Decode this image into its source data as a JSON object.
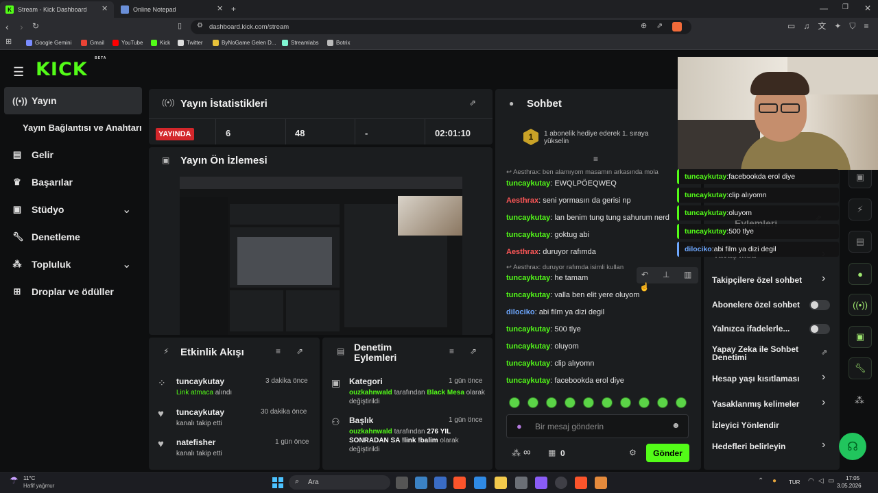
{
  "browser": {
    "tabs": [
      {
        "label": "Stream - Kick Dashboard",
        "icon": "kick-icon"
      },
      {
        "label": "Online Notepad",
        "icon": "notepad-icon"
      }
    ],
    "url": "dashboard.kick.com/stream",
    "bookmarks": [
      "Google Gemini",
      "Gmail",
      "YouTube",
      "Kick",
      "Twitter",
      "ByNoGame Gelen D...",
      "Streamlabs",
      "Botrix"
    ]
  },
  "sidebar": {
    "brand": "KICK",
    "brand_badge": "BETA",
    "items": [
      {
        "label": "Yayın",
        "icon": "broadcast-icon"
      },
      {
        "label": "Yayın Bağlantısı ve Anahtarı"
      },
      {
        "label": "Gelir",
        "icon": "revenue-icon"
      },
      {
        "label": "Başarılar",
        "icon": "trophy-icon"
      },
      {
        "label": "Stüdyo",
        "icon": "studio-icon"
      },
      {
        "label": "Denetleme",
        "icon": "wrench-icon"
      },
      {
        "label": "Topluluk",
        "icon": "community-icon"
      },
      {
        "label": "Droplar ve ödüller",
        "icon": "gift-icon"
      }
    ]
  },
  "stats": {
    "title": "Yayın İstatistikleri",
    "live_badge": "YAYINDA",
    "values": [
      "6",
      "48",
      "-",
      "02:01:10"
    ]
  },
  "preview": {
    "title": "Yayın Ön İzlemesi"
  },
  "activity": {
    "title": "Etkinlik Akışı",
    "items": [
      {
        "name": "tuncaykutay",
        "detail_link": "Link atmaca",
        "detail": "alındı",
        "time": "3 dakika önce"
      },
      {
        "name": "tuncaykutay",
        "detail": "kanalı takip etti",
        "time": "30 dakika önce"
      },
      {
        "name": "natefisher",
        "detail": "kanalı takip etti",
        "time": "1 gün önce"
      }
    ]
  },
  "moderation": {
    "title_line1": "Denetim",
    "title_line2": "Eylemleri",
    "items": [
      {
        "title": "Kategori",
        "time": "1 gün önce",
        "user": "ouzkahnwald",
        "mid": "tarafından",
        "value": "Black Mesa",
        "tail": "olarak değiştirildi"
      },
      {
        "title": "Başlık",
        "time": "1 gün önce",
        "user": "ouzkahnwald",
        "mid": "tarafından",
        "value": "276 YIL SONRADAN SA !link !balim",
        "tail": "olarak değiştirildi"
      }
    ]
  },
  "chat": {
    "title": "Sohbet",
    "gift_banner": "1 abonelik hediye ederek 1. sıraya yükselin",
    "gift_rank": "1",
    "reply1": "Aesthrax: ben alamıyom masamın arkasında mola",
    "reply2": "Aesthrax: duruyor rafımda isimli kullan",
    "messages": [
      {
        "user": "tuncaykutay",
        "text": "EWQLPÖEQWEQ",
        "color": "green"
      },
      {
        "user": "Aesthrax",
        "text": "seni yormasın da gerisi np",
        "color": "red"
      },
      {
        "user": "tuncaykutay",
        "text": "lan benim tung tung sahurum nerd",
        "color": "green"
      },
      {
        "user": "tuncaykutay",
        "text": "goktug abi",
        "color": "green"
      },
      {
        "user": "Aesthrax",
        "text": "duruyor rafımda",
        "color": "red"
      },
      {
        "user": "tuncaykutay",
        "text": "he tamam",
        "color": "green"
      },
      {
        "user": "tuncaykutay",
        "text": "valla ben elit yere oluyom",
        "color": "green"
      },
      {
        "user": "dilociko",
        "text": "abi film ya dizi degil",
        "color": "blue"
      },
      {
        "user": "tuncaykutay",
        "text": "500 tlye",
        "color": "green"
      },
      {
        "user": "tuncaykutay",
        "text": "oluyom",
        "color": "green"
      },
      {
        "user": "tuncaykutay",
        "text": "clip alıyomn",
        "color": "green"
      },
      {
        "user": "tuncaykutay",
        "text": "facebookda erol diye",
        "color": "green"
      }
    ],
    "input_placeholder": "Bir mesaj gönderin",
    "infinity": "∞",
    "count": "0",
    "send_label": "Gönder"
  },
  "chat_settings": {
    "partial_title": "Eylemleri",
    "slow_mode": "Yavaş mod",
    "items": [
      {
        "label": "Takipçilere özel sohbet",
        "type": "chevron"
      },
      {
        "label": "Abonelere özel sohbet",
        "type": "toggle"
      },
      {
        "label": "Yalnızca ifadelerle...",
        "type": "toggle"
      },
      {
        "label": "Yapay Zeka ile Sohbet Denetimi",
        "type": "external"
      },
      {
        "label": "Hesap yaşı kısıtlaması",
        "type": "chevron"
      },
      {
        "label": "Yasaklanmış kelimeler",
        "type": "chevron"
      },
      {
        "label": "İzleyici Yönlendir",
        "type": "none"
      },
      {
        "label": "Hedefleri belirleyin",
        "type": "chevron"
      }
    ]
  },
  "overlay_chat": [
    {
      "user": "tuncaykutay",
      "text": "facebookda erol diye",
      "color": "green"
    },
    {
      "user": "tuncaykutay",
      "text": "clip alıyomn",
      "color": "green"
    },
    {
      "user": "tuncaykutay",
      "text": "oluyom",
      "color": "green"
    },
    {
      "user": "tuncaykutay",
      "text": "500 tlye",
      "color": "green"
    },
    {
      "user": "dilociko",
      "text": "abi film ya dizi degil",
      "color": "blue"
    }
  ],
  "taskbar": {
    "weather_temp": "11°C",
    "weather_desc": "Hafif yağmur",
    "search": "Ara",
    "lang": "TUR",
    "time": "17:05",
    "date": "3.05.2026"
  }
}
